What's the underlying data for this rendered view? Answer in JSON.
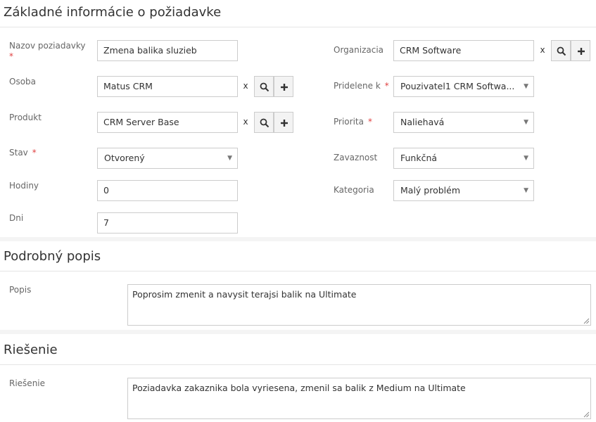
{
  "sections": {
    "basic": "Základné informácie o požiadavke",
    "detail": "Podrobný popis",
    "solution": "Riešenie"
  },
  "labels": {
    "request_name": "Nazov poziadavky",
    "organization": "Organizacia",
    "person": "Osoba",
    "assigned_to": "Pridelene k",
    "product": "Produkt",
    "priority": "Priorita",
    "status": "Stav",
    "severity": "Zavaznost",
    "hours": "Hodiny",
    "category": "Kategoria",
    "days": "Dni",
    "description": "Popis",
    "solution": "Riešenie",
    "required_mark": "*",
    "clear_mark": "x"
  },
  "fields": {
    "request_name": "Zmena balika sluzieb",
    "organization": "CRM Software",
    "person": "Matus CRM",
    "assigned_to": "Pouzivatel1 CRM Softwa...",
    "product": "CRM Server Base",
    "priority": "Naliehavá",
    "status": "Otvorený",
    "severity": "Funkčná",
    "hours": "0",
    "category": "Malý problém",
    "days": "7",
    "description": "Poprosim zmenit a navysit terajsi balik na Ultimate",
    "solution": "Poziadavka zakaznika bola vyriesena, zmenil sa balik z Medium na Ultimate"
  },
  "icons": {
    "search": "search-icon",
    "add": "plus-icon",
    "dropdown": "caret-down-icon",
    "resize": "resize-grip-icon"
  },
  "colors": {
    "required": "#e04040",
    "border": "#cccccc",
    "button_bg": "#f3f3f3"
  }
}
